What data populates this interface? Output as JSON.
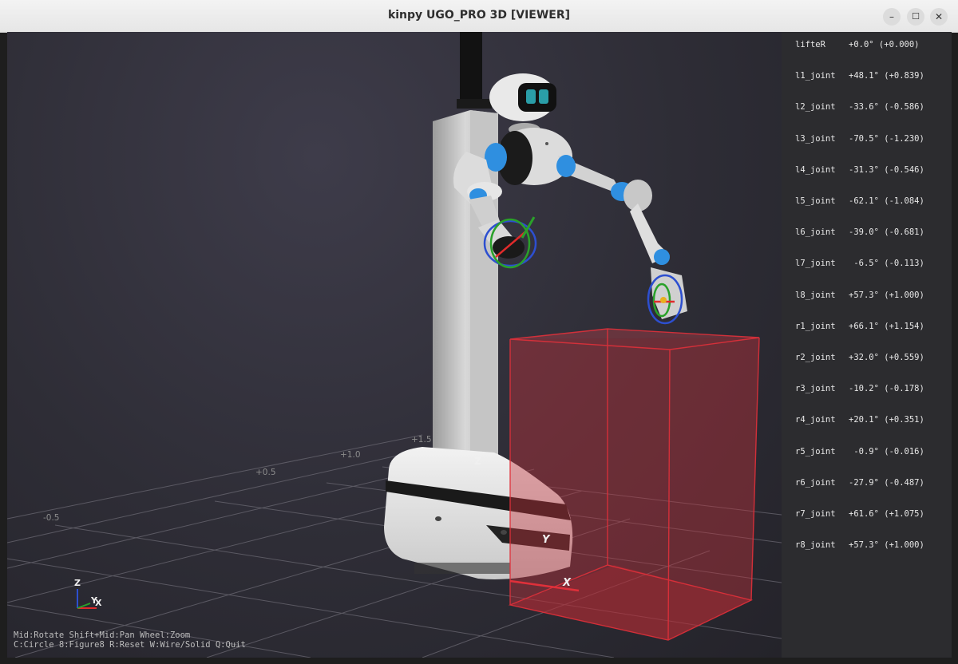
{
  "window": {
    "title": "kinpy UGO_PRO 3D [VIEWER]",
    "minimize": "–",
    "maximize": "☐",
    "close": "✕"
  },
  "joints": [
    {
      "name": "lifteR",
      "value": "+0.0° (+0.000)"
    },
    {
      "name": "l1_joint",
      "value": "+48.1° (+0.839)"
    },
    {
      "name": "l2_joint",
      "value": "-33.6° (-0.586)"
    },
    {
      "name": "l3_joint",
      "value": "-70.5° (-1.230)"
    },
    {
      "name": "l4_joint",
      "value": "-31.3° (-0.546)"
    },
    {
      "name": "l5_joint",
      "value": "-62.1° (-1.084)"
    },
    {
      "name": "l6_joint",
      "value": "-39.0° (-0.681)"
    },
    {
      "name": "l7_joint",
      "value": " -6.5° (-0.113)"
    },
    {
      "name": "l8_joint",
      "value": "+57.3° (+1.000)"
    },
    {
      "name": "r1_joint",
      "value": "+66.1° (+1.154)"
    },
    {
      "name": "r2_joint",
      "value": "+32.0° (+0.559)"
    },
    {
      "name": "r3_joint",
      "value": "-10.2° (-0.178)"
    },
    {
      "name": "r4_joint",
      "value": "+20.1° (+0.351)"
    },
    {
      "name": "r5_joint",
      "value": " -0.9° (-0.016)"
    },
    {
      "name": "r6_joint",
      "value": "-27.9° (-0.487)"
    },
    {
      "name": "r7_joint",
      "value": "+61.6° (+1.075)"
    },
    {
      "name": "r8_joint",
      "value": "+57.3° (+1.000)"
    }
  ],
  "grid_ticks": [
    "+1.5",
    "+1.0",
    "+0.5",
    "-0.5"
  ],
  "axes": {
    "z": "Z",
    "y": "Y",
    "x": "X",
    "gizmo_z": "Z",
    "gizmo_y": "Y",
    "gizmo_x": "X"
  },
  "help": {
    "line1": "Mid:Rotate Shift+Mid:Pan Wheel:Zoom",
    "line2": "C:Circle 8:Figure8 R:Reset W:Wire/Solid Q:Quit"
  },
  "colors": {
    "workspace_box": "#e0303a",
    "panel_bg": "#2c2c2f"
  }
}
